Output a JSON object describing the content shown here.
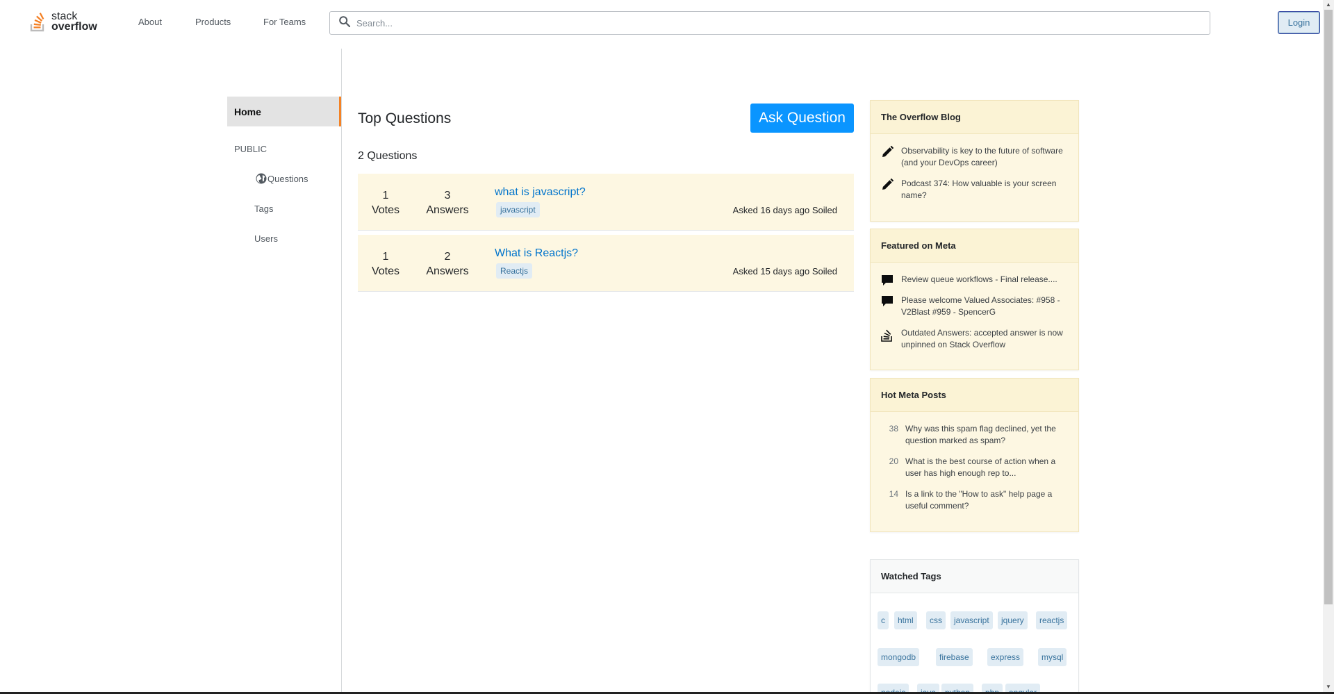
{
  "header": {
    "logo_line1": "stack",
    "logo_line2": "overflow",
    "nav": [
      "About",
      "Products",
      "For Teams"
    ],
    "search_placeholder": "Search...",
    "login_label": "Login"
  },
  "sidebar": {
    "home_label": "Home",
    "public_label": "PUBLIC",
    "items": [
      "Questions",
      "Tags",
      "Users"
    ]
  },
  "main": {
    "title": "Top Questions",
    "ask_button": "Ask Question",
    "count_label": "2 Questions",
    "questions": [
      {
        "votes": "1",
        "votes_label": "Votes",
        "answers": "3",
        "answers_label": "Answers",
        "title": "what is javascript?",
        "tag": "javascript",
        "meta": "Asked 16 days ago Soiled"
      },
      {
        "votes": "1",
        "votes_label": "Votes",
        "answers": "2",
        "answers_label": "Answers",
        "title": "What is Reactjs?",
        "tag": "Reactjs",
        "meta": "Asked 15 days ago Soiled"
      }
    ]
  },
  "widgets": {
    "blog": {
      "title": "The Overflow Blog",
      "items": [
        "Observability is key to the future of software (and your DevOps career)",
        "Podcast 374: How valuable is your screen name?"
      ]
    },
    "meta": {
      "title": "Featured on Meta",
      "items": [
        "Review queue workflows - Final release....",
        "Please welcome Valued Associates: #958 - V2Blast #959 - SpencerG",
        "Outdated Answers: accepted answer is now unpinned on Stack Overflow"
      ]
    },
    "hot": {
      "title": "Hot Meta Posts",
      "items": [
        {
          "num": "38",
          "text": "Why was this spam flag declined, yet the question marked as spam?"
        },
        {
          "num": "20",
          "text": "What is the best course of action when a user has high enough rep to..."
        },
        {
          "num": "14",
          "text": "Is a link to the \"How to ask\" help page a useful comment?"
        }
      ]
    },
    "watched": {
      "title": "Watched Tags",
      "tags": [
        "c",
        "html",
        "css",
        "javascript",
        "jquery",
        "reactjs",
        "mongodb",
        "firebase",
        "express",
        "mysql",
        "nodejs",
        "java",
        "python",
        "php",
        "angular"
      ]
    }
  },
  "colors": {
    "accent_orange": "#f48225",
    "ask_blue": "#0a95ff",
    "link_blue": "#0074cc",
    "widget_bg": "#fdf7e2",
    "tag_bg": "#e1ecf4"
  }
}
